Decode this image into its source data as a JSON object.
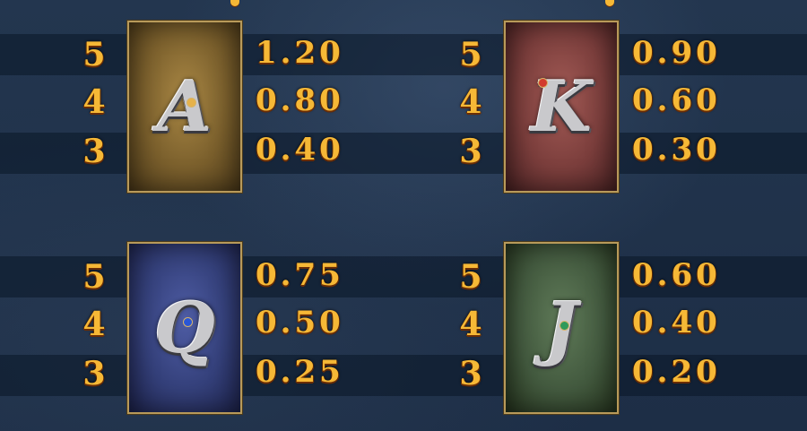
{
  "paytable": [
    {
      "symbol": "A",
      "card_color": "#8b6b33",
      "gem_color": "#e6b24a",
      "rows": [
        {
          "count": "5",
          "pay": "1.20"
        },
        {
          "count": "4",
          "pay": "0.80"
        },
        {
          "count": "3",
          "pay": "0.40"
        }
      ]
    },
    {
      "symbol": "K",
      "card_color": "#7b3e3c",
      "gem_color": "#d23a2c",
      "rows": [
        {
          "count": "5",
          "pay": "0.90"
        },
        {
          "count": "4",
          "pay": "0.60"
        },
        {
          "count": "3",
          "pay": "0.30"
        }
      ]
    },
    {
      "symbol": "Q",
      "card_color": "#34407a",
      "gem_color": "#2a56d6",
      "rows": [
        {
          "count": "5",
          "pay": "0.75"
        },
        {
          "count": "4",
          "pay": "0.50"
        },
        {
          "count": "3",
          "pay": "0.25"
        }
      ]
    },
    {
      "symbol": "J",
      "card_color": "#435a3f",
      "gem_color": "#2e9a5a",
      "rows": [
        {
          "count": "5",
          "pay": "0.60"
        },
        {
          "count": "4",
          "pay": "0.40"
        },
        {
          "count": "3",
          "pay": "0.20"
        }
      ]
    }
  ],
  "colors": {
    "value_gold": "#f6b836",
    "background": "#1f304a"
  }
}
